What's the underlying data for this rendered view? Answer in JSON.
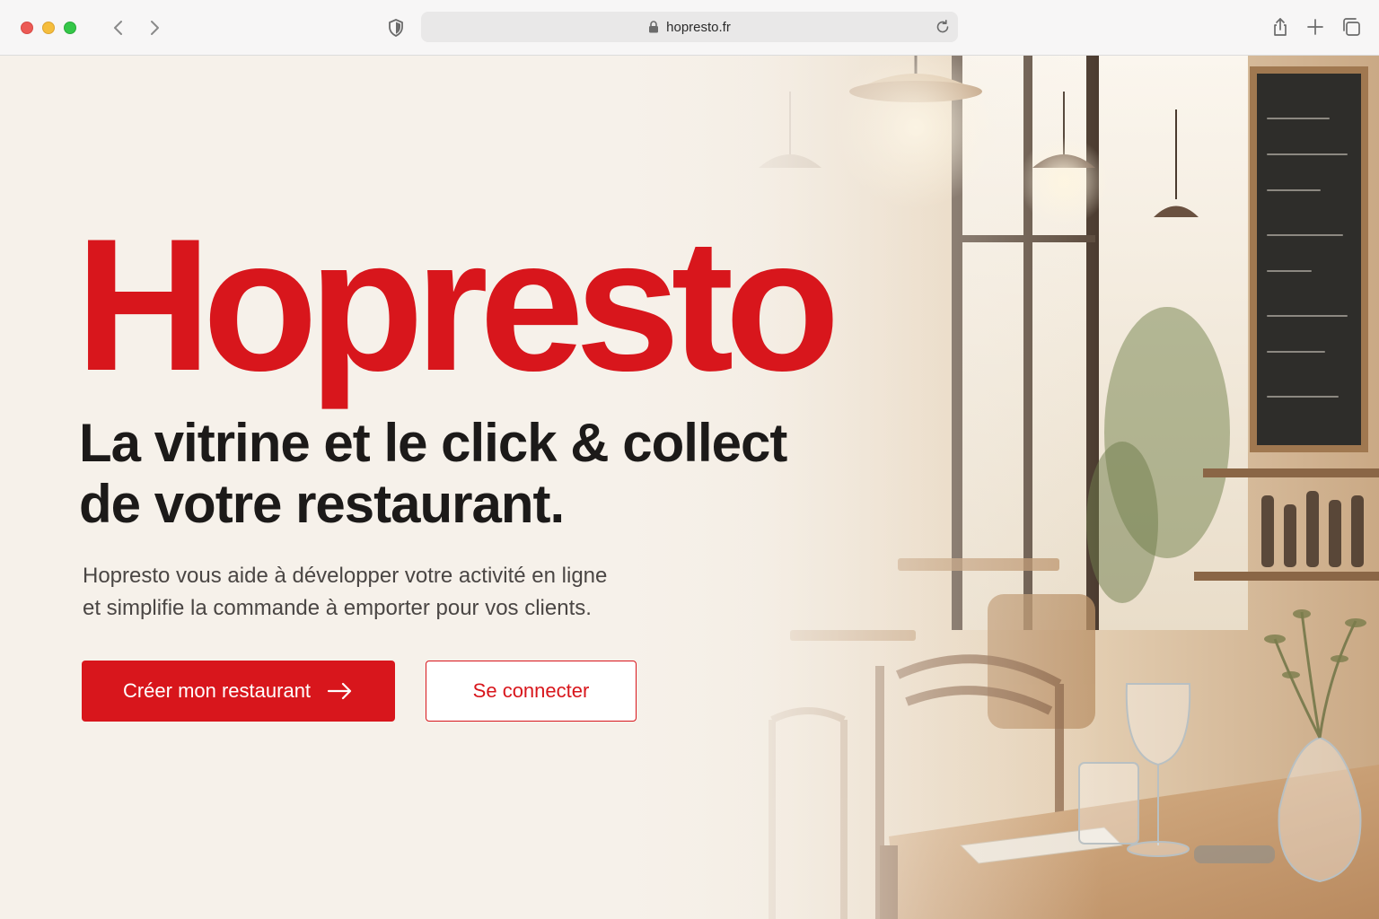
{
  "browser": {
    "url": "hopresto.fr",
    "icons": [
      "close-dot",
      "minimize-dot",
      "maximize-dot",
      "chevron-left-icon",
      "chevron-right-icon",
      "shield-icon",
      "lock-icon",
      "reload-icon",
      "share-icon",
      "plus-icon",
      "tabs-icon"
    ]
  },
  "hero": {
    "brand": "Hopresto",
    "headline_line1": "La vitrine et le click & collect",
    "headline_line2": "de votre restaurant.",
    "description_line1": "Hopresto vous aide à développer votre activité en ligne",
    "description_line2": "et simplifie la commande à emporter pour vos clients.",
    "primary_button": "Créer mon restaurant",
    "secondary_button": "Se connecter",
    "primary_button_icon": "arrow-right-icon"
  },
  "colors": {
    "brand_red": "#d8161c",
    "headline": "#1c1a19",
    "background": "#f6f1ea"
  }
}
